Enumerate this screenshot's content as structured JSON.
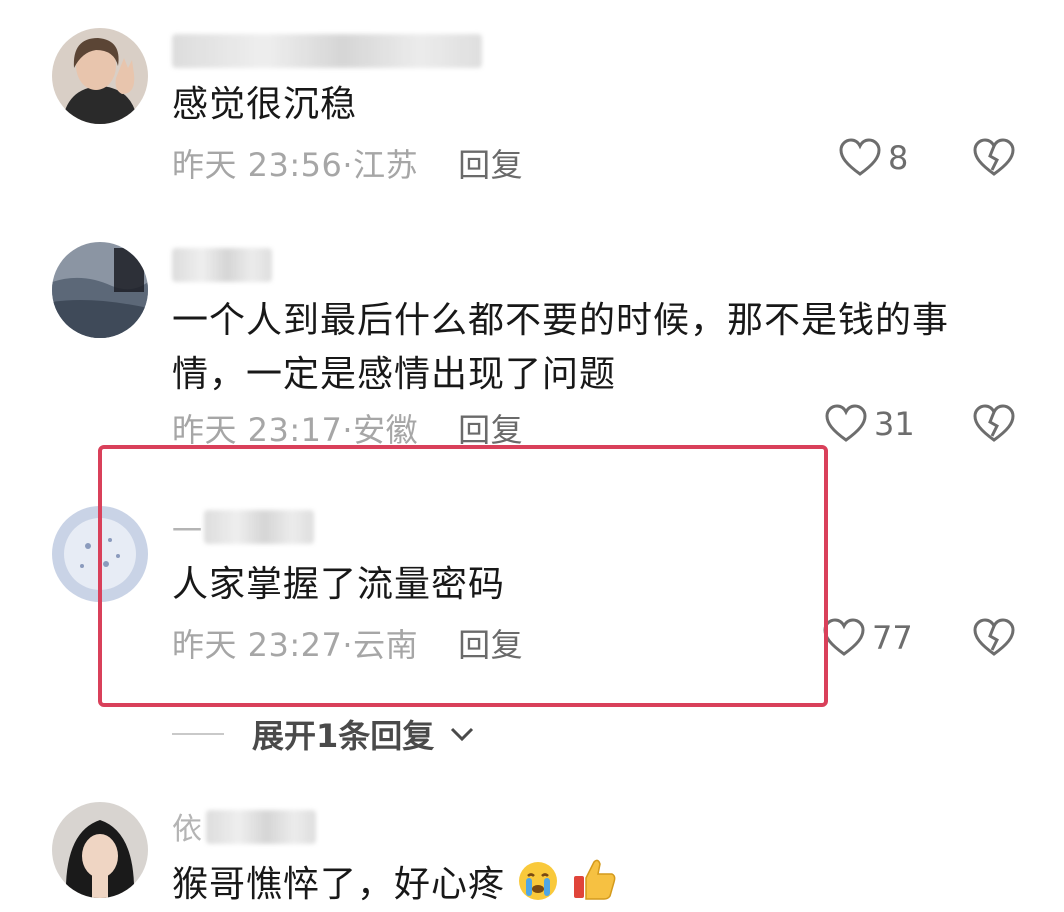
{
  "comments": [
    {
      "text": "感觉很沉稳",
      "time": "昨天 23:56",
      "location": "江苏",
      "reply_label": "回复",
      "likes": "8"
    },
    {
      "text": "一个人到最后什么都不要的时候，那不是钱的事情，一定是感情出现了问题",
      "time": "昨天 23:17",
      "location": "安徽",
      "reply_label": "回复",
      "likes": "31"
    },
    {
      "name_prefix": "一",
      "text": "人家掌握了流量密码",
      "time": "昨天 23:27",
      "location": "云南",
      "reply_label": "回复",
      "likes": "77",
      "expand_label": "展开1条回复"
    },
    {
      "name_prefix": "依",
      "text": "猴哥憔悴了，好心疼"
    }
  ],
  "colors": {
    "highlight_border": "#d9405a",
    "meta_text": "#a6a6a6"
  },
  "icons": [
    "heart-outline-icon",
    "broken-heart-icon",
    "chevron-down-icon",
    "crying-face-emoji",
    "thumbs-up-emoji"
  ]
}
